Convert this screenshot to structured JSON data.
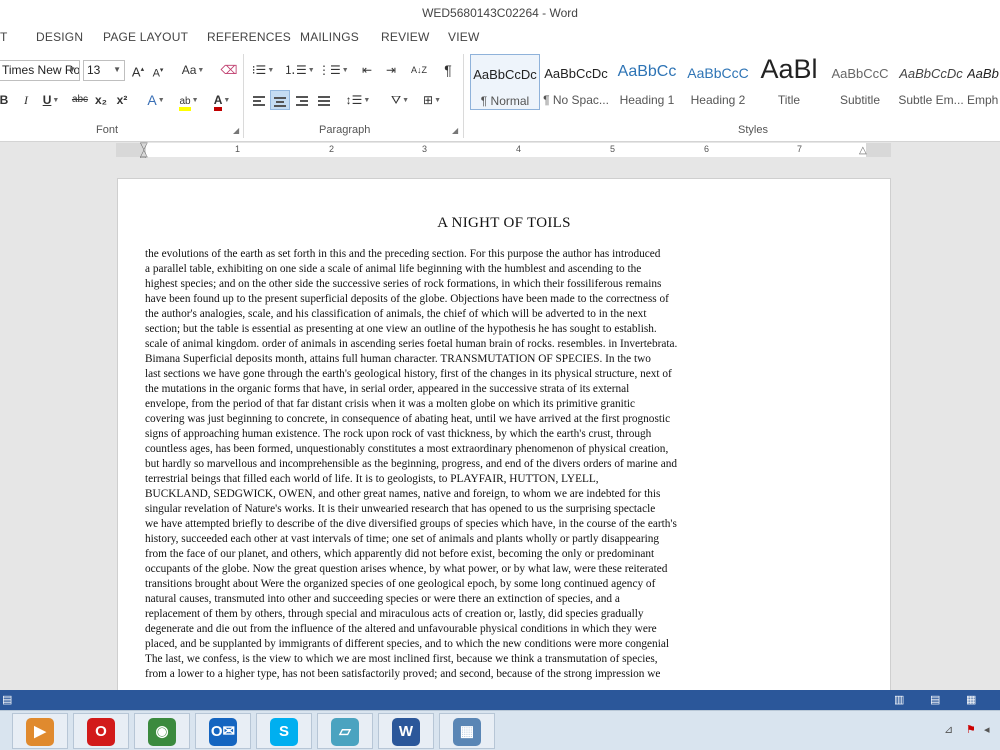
{
  "window": {
    "title": "WED5680143C02264 - Word"
  },
  "ribbon_tabs": [
    "T",
    "DESIGN",
    "PAGE LAYOUT",
    "REFERENCES",
    "MAILINGS",
    "REVIEW",
    "VIEW"
  ],
  "font_group": {
    "font_name": "Times New Ro",
    "font_size": "13",
    "label": "Font",
    "grow": "A",
    "shrink": "A",
    "case": "Aa",
    "bold": "B",
    "italic": "I",
    "underline": "U",
    "strike": "abc",
    "subscript": "x₂",
    "superscript": "x²",
    "effects": "A",
    "highlight": "ab",
    "font_color": "A",
    "font_color_hex": "#c00000",
    "highlight_hex": "#ffff00"
  },
  "paragraph_group": {
    "label": "Paragraph",
    "pilcrow": "¶",
    "sort": "A↓Z"
  },
  "styles_group": {
    "label": "Styles",
    "items": [
      {
        "preview": "AaBbCcDc",
        "name": "¶ Normal"
      },
      {
        "preview": "AaBbCcDc",
        "name": "¶ No Spac..."
      },
      {
        "preview": "AaBbCc",
        "name": "Heading 1"
      },
      {
        "preview": "AaBbCcC",
        "name": "Heading 2"
      },
      {
        "preview": "AaBl",
        "name": "Title"
      },
      {
        "preview": "AaBbCcC",
        "name": "Subtitle"
      },
      {
        "preview": "AaBbCcDc",
        "name": "Subtle Em..."
      },
      {
        "preview": "AaBb",
        "name": "Emph"
      }
    ]
  },
  "ruler": {
    "numbers": [
      "1",
      "2",
      "3",
      "4",
      "5",
      "6",
      "7"
    ]
  },
  "document": {
    "heading": "A NIGHT OF TOILS",
    "lines": [
      "the evolutions of the earth as set forth in this and the preceding section. For this purpose the author has introduced",
      "a parallel table, exhibiting on one side a scale of animal life beginning with the humblest and ascending to the",
      "highest species; and on the other side the successive series of rock formations, in which their fossiliferous remains",
      "have been found up to the present superficial deposits of the globe. Objections have been made to the correctness of",
      "the author's analogies, scale, and his classification of animals, the chief of which will be adverted to in the next",
      "section; but the table is essential as presenting at one view an outline of the hypothesis he has sought to establish.",
      "scale of animal kingdom. order of animals in ascending series foetal human brain of rocks. resembles. in Invertebrata.",
      "Bimana Superficial deposits month, attains full human character. TRANSMUTATION OF SPECIES. In the two",
      "last sections we have gone through the earth's geological history, first of the changes in its physical structure, next of",
      "the mutations in the organic forms that have, in serial order, appeared in the successive strata of its external",
      "envelope, from the period of that far distant crisis when it was a molten globe on which its primitive granitic",
      "covering was just beginning to concrete, in consequence of abating heat, until we have arrived at the first prognostic",
      "signs of approaching human existence. The rock upon rock of vast thickness, by which the earth's crust, through",
      "countless ages, has been formed, unquestionably constitutes a most extraordinary phenomenon of physical creation,",
      "but hardly so marvellous and incomprehensible as the beginning, progress, and end of the divers orders of marine and",
      "terrestrial beings that filled each world of life. It is to geologists, to PLAYFAIR, HUTTON, LYELL,",
      "BUCKLAND, SEDGWICK, OWEN, and other great names, native and foreign, to whom we are indebted for this",
      "singular revelation of Nature's works. It is their unwearied research that has opened to us the surprising spectacle",
      "we have attempted briefly to describe of the dive diversified groups of species which have, in the course of the earth's",
      "history, succeeded each other at vast intervals of time; one set of animals and plants wholly or partly disappearing",
      "from the face of our planet, and others, which apparently did not before exist, becoming the only or predominant",
      "occupants of the globe. Now the great question arises whence, by what power, or by what law, were these reiterated",
      "transitions brought about Were the organized species of one geological epoch, by some long continued agency of",
      "natural causes, transmuted into other and succeeding species or were there an extinction of species, and a",
      "replacement of them by others, through special and miraculous acts of creation or, lastly, did species gradually",
      "degenerate and die out from the influence of the altered and unfavourable physical conditions in which they were",
      "placed, and be supplanted by immigrants of different species, and to which the new conditions were more congenial",
      "The last, we confess, is the view to which we are most inclined first, because we think a transmutation of species,",
      "from a lower to a higher type, has not been satisfactorily proved; and second, because of the strong impression we"
    ]
  },
  "taskbar": {
    "apps": [
      {
        "name": "media",
        "glyph": "▶",
        "color": "#e08a2e"
      },
      {
        "name": "opera",
        "glyph": "O",
        "color": "#d21a1a"
      },
      {
        "name": "chrome",
        "glyph": "◉",
        "color": "#3b8a3e"
      },
      {
        "name": "outlook",
        "glyph": "O✉",
        "color": "#1565c0"
      },
      {
        "name": "skype",
        "glyph": "S",
        "color": "#00aff0"
      },
      {
        "name": "notes",
        "glyph": "▱",
        "color": "#4aa3c0"
      },
      {
        "name": "word",
        "glyph": "W",
        "color": "#2b579a"
      },
      {
        "name": "photos",
        "glyph": "▦",
        "color": "#5a86b5"
      }
    ]
  }
}
